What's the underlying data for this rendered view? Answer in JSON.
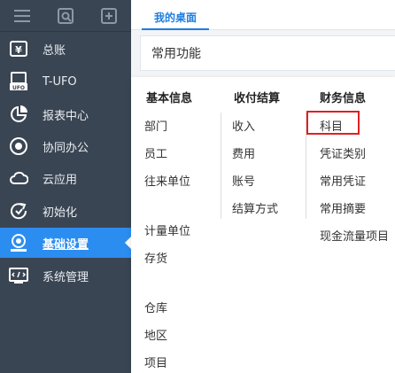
{
  "header": {
    "tab_label": "我的桌面"
  },
  "card": {
    "title": "常用功能"
  },
  "topbar": {
    "icons": [
      "menu-icon",
      "search-icon",
      "add-icon"
    ]
  },
  "sidebar": {
    "items": [
      {
        "label": "总账",
        "icon": "ledger-icon"
      },
      {
        "label": "T-UFO",
        "icon": "ufo-icon"
      },
      {
        "label": "报表中心",
        "icon": "report-icon"
      },
      {
        "label": "协同办公",
        "icon": "collab-icon"
      },
      {
        "label": "云应用",
        "icon": "cloud-icon"
      },
      {
        "label": "初始化",
        "icon": "init-icon"
      },
      {
        "label": "基础设置",
        "icon": "settings-icon",
        "active": true
      },
      {
        "label": "系统管理",
        "icon": "system-icon"
      }
    ]
  },
  "dropdown": {
    "columns": [
      {
        "heading": "基本信息",
        "items": [
          "部门",
          "员工",
          "往来单位",
          "计量单位",
          "存货",
          "仓库",
          "地区",
          "项目"
        ]
      },
      {
        "heading": "收付结算",
        "items": [
          "收入",
          "费用",
          "账号",
          "结算方式"
        ]
      },
      {
        "heading": "财务信息",
        "items": [
          "科目",
          "凭证类别",
          "常用凭证",
          "常用摘要",
          "现金流量项目"
        ]
      }
    ],
    "highlighted_item": "科目"
  },
  "colors": {
    "sidebar_bg": "#3a4553",
    "active_bg": "#2c8df0",
    "accent": "#1e7de0",
    "highlight_border": "#e02020"
  }
}
